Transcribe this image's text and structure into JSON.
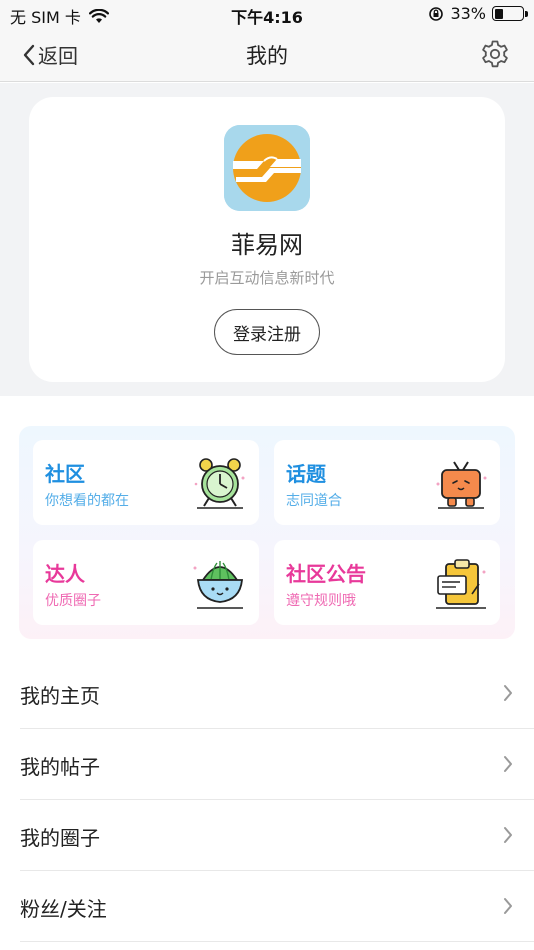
{
  "status_bar": {
    "carrier": "无 SIM 卡",
    "time": "下午4:16",
    "battery": "33%",
    "battery_level": 0.33
  },
  "nav": {
    "back_label": "返回",
    "title": "我的"
  },
  "profile": {
    "app_name": "菲易网",
    "slogan": "开启互动信息新时代",
    "login_label": "登录注册"
  },
  "grid": [
    {
      "title": "社区",
      "subtitle": "你想看的都在",
      "title_color": "#1f8fe0",
      "sub_color": "#55aee8",
      "icon": "alarm-clock-icon"
    },
    {
      "title": "话题",
      "subtitle": "志同道合",
      "title_color": "#1f8fe0",
      "sub_color": "#55aee8",
      "icon": "tv-character-icon"
    },
    {
      "title": "达人",
      "subtitle": "优质圈子",
      "title_color": "#e8399a",
      "sub_color": "#ef6ab3",
      "icon": "cactus-pot-icon"
    },
    {
      "title": "社区公告",
      "subtitle": "遵守规则哦",
      "title_color": "#e8399a",
      "sub_color": "#ef6ab3",
      "icon": "clipboard-icon"
    }
  ],
  "menu": [
    {
      "label": "我的主页"
    },
    {
      "label": "我的帖子"
    },
    {
      "label": "我的圈子"
    },
    {
      "label": "粉丝/关注"
    }
  ]
}
